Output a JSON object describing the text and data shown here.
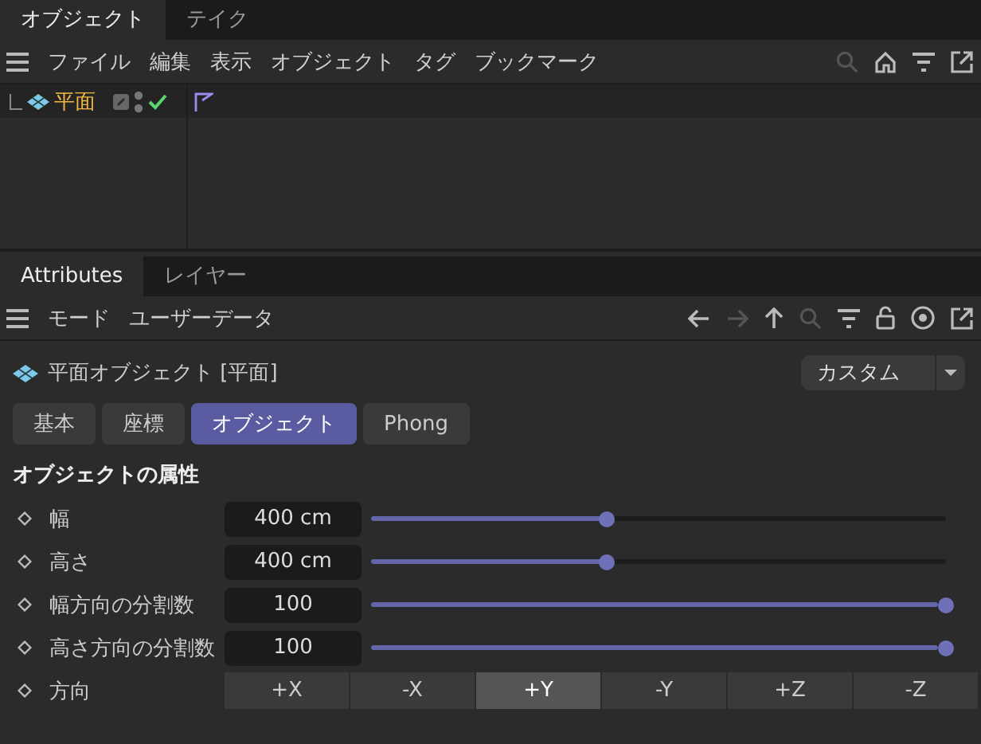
{
  "object_manager": {
    "tabs": [
      {
        "label": "オブジェクト",
        "selected": true
      },
      {
        "label": "テイク",
        "selected": false
      }
    ],
    "menu": [
      "ファイル",
      "編集",
      "表示",
      "オブジェクト",
      "タグ",
      "ブックマーク"
    ],
    "objects": [
      {
        "name": "平面",
        "selected": true
      }
    ]
  },
  "attribute_manager": {
    "tabs": [
      {
        "label": "Attributes",
        "selected": true
      },
      {
        "label": "レイヤー",
        "selected": false
      }
    ],
    "menu": [
      "モード",
      "ユーザーデータ"
    ],
    "object_title": "平面オブジェクト [平面]",
    "mode_dropdown": {
      "value": "カスタム"
    },
    "subtabs": [
      {
        "label": "基本",
        "selected": false
      },
      {
        "label": "座標",
        "selected": false
      },
      {
        "label": "オブジェクト",
        "selected": true
      },
      {
        "label": "Phong",
        "selected": false
      }
    ],
    "section_title": "オブジェクトの属性",
    "params": [
      {
        "kind": "number",
        "label": "幅",
        "value": "400 cm",
        "level": 0.41
      },
      {
        "kind": "number",
        "label": "高さ",
        "value": "400 cm",
        "level": 0.41
      },
      {
        "kind": "number",
        "label": "幅方向の分割数",
        "value": "100",
        "level": 1
      },
      {
        "kind": "number",
        "label": "高さ方向の分割数",
        "value": "100",
        "level": 1
      },
      {
        "kind": "choice",
        "label": "方向",
        "options": [
          {
            "label": "+X",
            "selected": false
          },
          {
            "label": "-X",
            "selected": false
          },
          {
            "label": "+Y",
            "selected": true
          },
          {
            "label": "-Y",
            "selected": false
          },
          {
            "label": "+Z",
            "selected": false
          },
          {
            "label": "-Z",
            "selected": false
          }
        ]
      }
    ]
  }
}
